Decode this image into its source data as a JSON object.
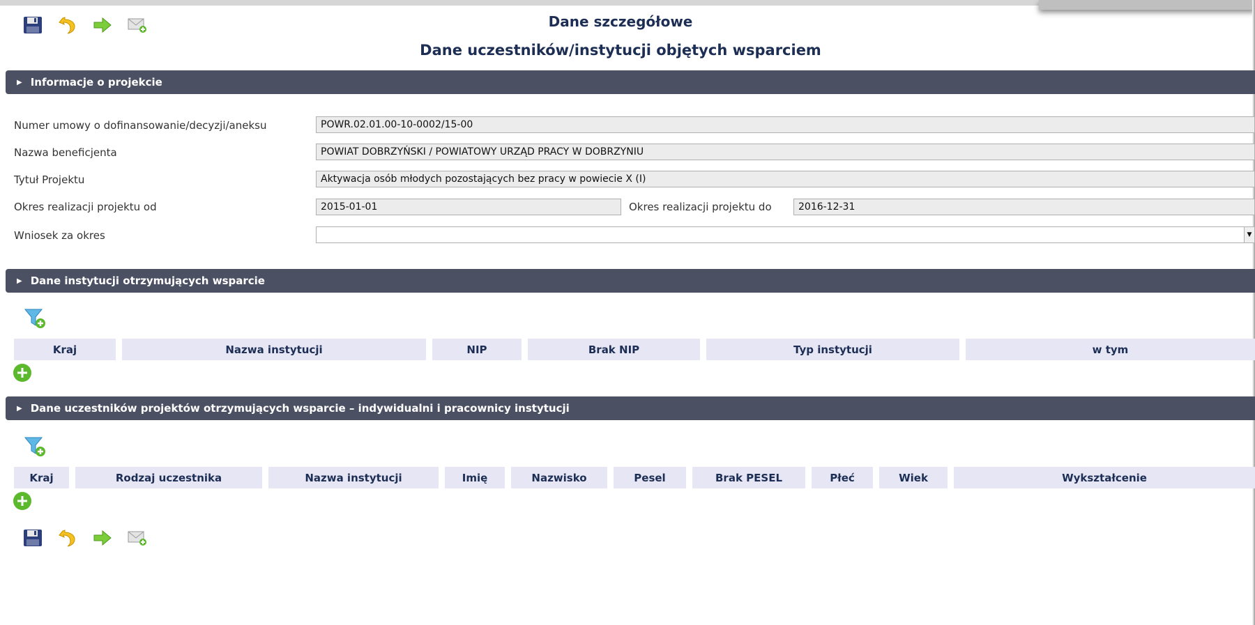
{
  "title": "Dane szczegółowe",
  "subtitle": "Dane uczestników/instytucji objętych wsparciem",
  "toolbar": {
    "icons": [
      "save-icon",
      "undo-icon",
      "forward-arrow-icon",
      "send-mail-icon"
    ]
  },
  "sections": {
    "project_info": "Informacje o projekcie",
    "institutions": "Dane instytucji otrzymujących wsparcie",
    "participants": "Dane uczestników projektów otrzymujących wsparcie – indywidualni i pracownicy instytucji"
  },
  "project": {
    "contract_number_label": "Numer umowy o dofinansowanie/decyzji/aneksu",
    "contract_number": "POWR.02.01.00-10-0002/15-00",
    "beneficiary_label": "Nazwa beneficjenta",
    "beneficiary": "POWIAT DOBRZYŃSKI / POWIATOWY URZĄD PRACY W DOBRZYNIU",
    "title_label": "Tytuł Projektu",
    "title": "Aktywacja osób młodych pozostających bez pracy w powiecie X (I)",
    "period_from_label": "Okres realizacji projektu od",
    "period_from": "2015-01-01",
    "period_to_label": "Okres realizacji projektu do",
    "period_to": "2016-12-31",
    "application_period_label": "Wniosek za okres",
    "application_period": ""
  },
  "institutions_table": {
    "columns": [
      "Kraj",
      "Nazwa instytucji",
      "NIP",
      "Brak NIP",
      "Typ instytucji",
      "w tym"
    ]
  },
  "participants_table": {
    "columns": [
      "Kraj",
      "Rodzaj uczestnika",
      "Nazwa instytucji",
      "Imię",
      "Nazwisko",
      "Pesel",
      "Brak PESEL",
      "Płeć",
      "Wiek",
      "Wykształcenie"
    ]
  },
  "colors": {
    "section_bar": "#4c5063",
    "header_cell": "#e6e6f4",
    "title_text": "#1d2e55",
    "field_bg": "#ececec"
  }
}
